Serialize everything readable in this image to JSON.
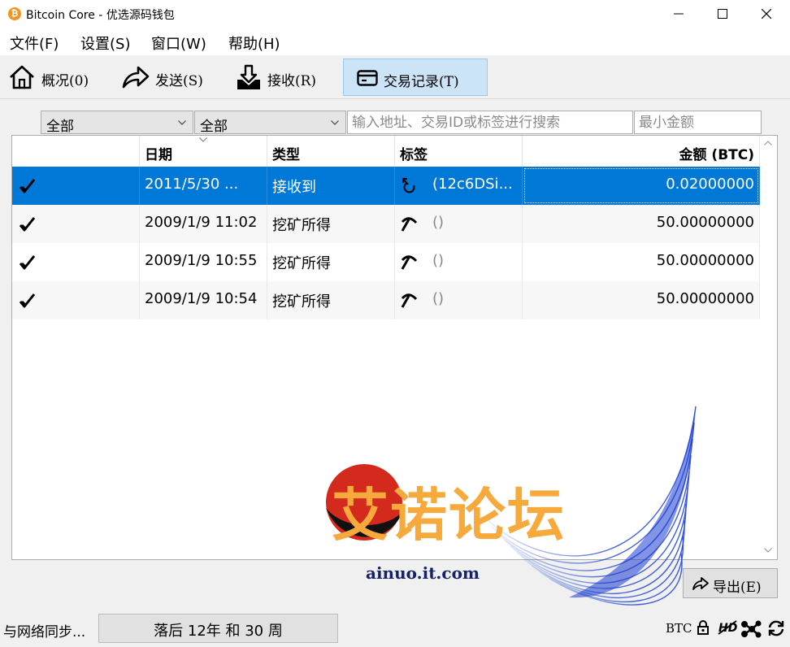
{
  "window": {
    "title": "Bitcoin Core - 优选源码钱包",
    "app_icon_glyph": "₿"
  },
  "menu": {
    "items": [
      "文件(F)",
      "设置(S)",
      "窗口(W)",
      "帮助(H)"
    ]
  },
  "toolbar": {
    "overview_label": "概况(0)",
    "send_label": "发送(S)",
    "receive_label": "接收(R)",
    "transactions_label": "交易记录(T)",
    "active_tab": "transactions"
  },
  "filters": {
    "date_value": "全部",
    "type_value": "全部",
    "search_placeholder": "输入地址、交易ID或标签进行搜索",
    "min_amount_placeholder": "最小金额"
  },
  "table": {
    "columns": [
      "",
      "日期",
      "类型",
      "标签",
      "金额 (BTC)"
    ],
    "rows": [
      {
        "status_icon": "check-icon",
        "date": "2011/5/30 ...",
        "type": "接收到",
        "label_icon": "receive-icon",
        "label": "(12c6DSi...",
        "amount": "0.02000000",
        "selected": true
      },
      {
        "status_icon": "check-icon",
        "date": "2009/1/9 11:02",
        "type": "挖矿所得",
        "label_icon": "mining-icon",
        "label": "()",
        "amount": "50.00000000",
        "selected": false
      },
      {
        "status_icon": "check-icon",
        "date": "2009/1/9 10:55",
        "type": "挖矿所得",
        "label_icon": "mining-icon",
        "label": "()",
        "amount": "50.00000000",
        "selected": false
      },
      {
        "status_icon": "check-icon",
        "date": "2009/1/9 10:54",
        "type": "挖矿所得",
        "label_icon": "mining-icon",
        "label": "()",
        "amount": "50.00000000",
        "selected": false
      }
    ]
  },
  "watermark": {
    "text": "艾诺论坛",
    "url": "ainuo.it.com"
  },
  "export": {
    "label": "导出(E)"
  },
  "status": {
    "sync_text": "与网络同步...",
    "behind_text": "落后 12年 和 30 周",
    "unit": "BTC",
    "icons": [
      "lock-icon",
      "hd-disabled-icon",
      "network-icon",
      "sync-icon"
    ]
  },
  "colors": {
    "selection": "#0078d7",
    "active_tab": "#cce4f7",
    "watermark_orange": "#f7a93b",
    "watermark_navy": "#15226b"
  }
}
